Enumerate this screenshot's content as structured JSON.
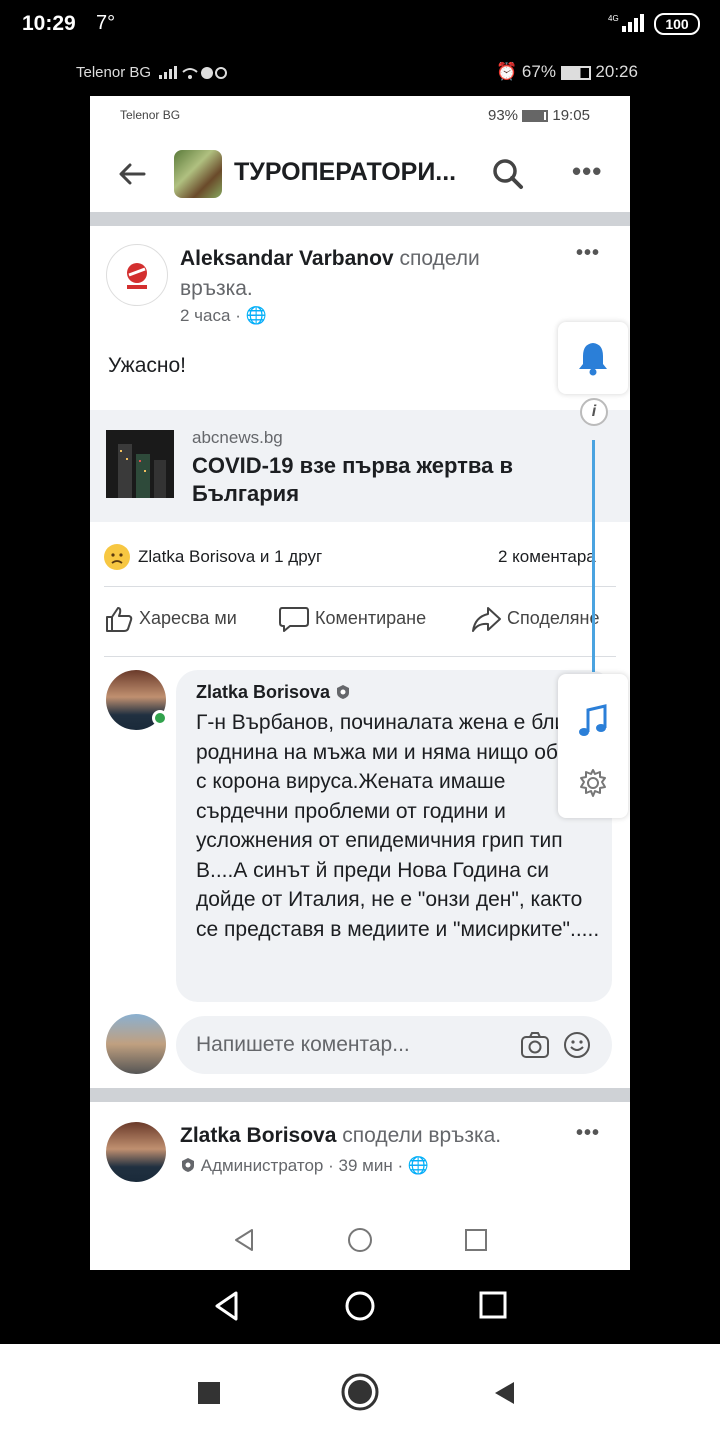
{
  "outer_status": {
    "time": "10:29",
    "temperature": "7°",
    "network": "4G",
    "battery": "100"
  },
  "middle_status": {
    "carrier": "Telenor BG",
    "battery": "67%",
    "time": "20:26"
  },
  "inner_status": {
    "carrier": "Telenor BG",
    "battery": "93%",
    "time": "19:05"
  },
  "header": {
    "title": "ТУРОПЕРАТОРИ..."
  },
  "post": {
    "author": "Aleksandar Varbanov",
    "action": "сподели връзка.",
    "time": "2 часа",
    "text": "Ужасно!",
    "link": {
      "domain": "abcnews.bg",
      "title": "COVID-19 взе първа жертва в България"
    },
    "reactions": {
      "names": "Zlatka Borisova и 1 друг",
      "comments": "2 коментара"
    },
    "actions": {
      "like": "Харесва ми",
      "comment": "Коментиране",
      "share": "Споделяне"
    }
  },
  "comment": {
    "author": "Zlatka Borisova",
    "text": "Г-н Върбанов, починалата жена е близка роднина на мъжа ми и няма нищо общо с корона вируса.Жената имаше сърдечни проблеми от години и усложнения от епидемичния грип тип В....А синът й преди Нова Година си дойде от Италия, не е \"онзи ден\", както се представя в медиите и \"мисирките\"....."
  },
  "write_comment": {
    "placeholder": "Напишете коментар..."
  },
  "post2": {
    "author": "Zlatka Borisova",
    "action": "сподели връзка.",
    "role": "Администратор",
    "time": "39 мин"
  },
  "colors": {
    "accent": "#1877f2",
    "panel_line": "#4aa3e0",
    "online": "#31a24c"
  }
}
